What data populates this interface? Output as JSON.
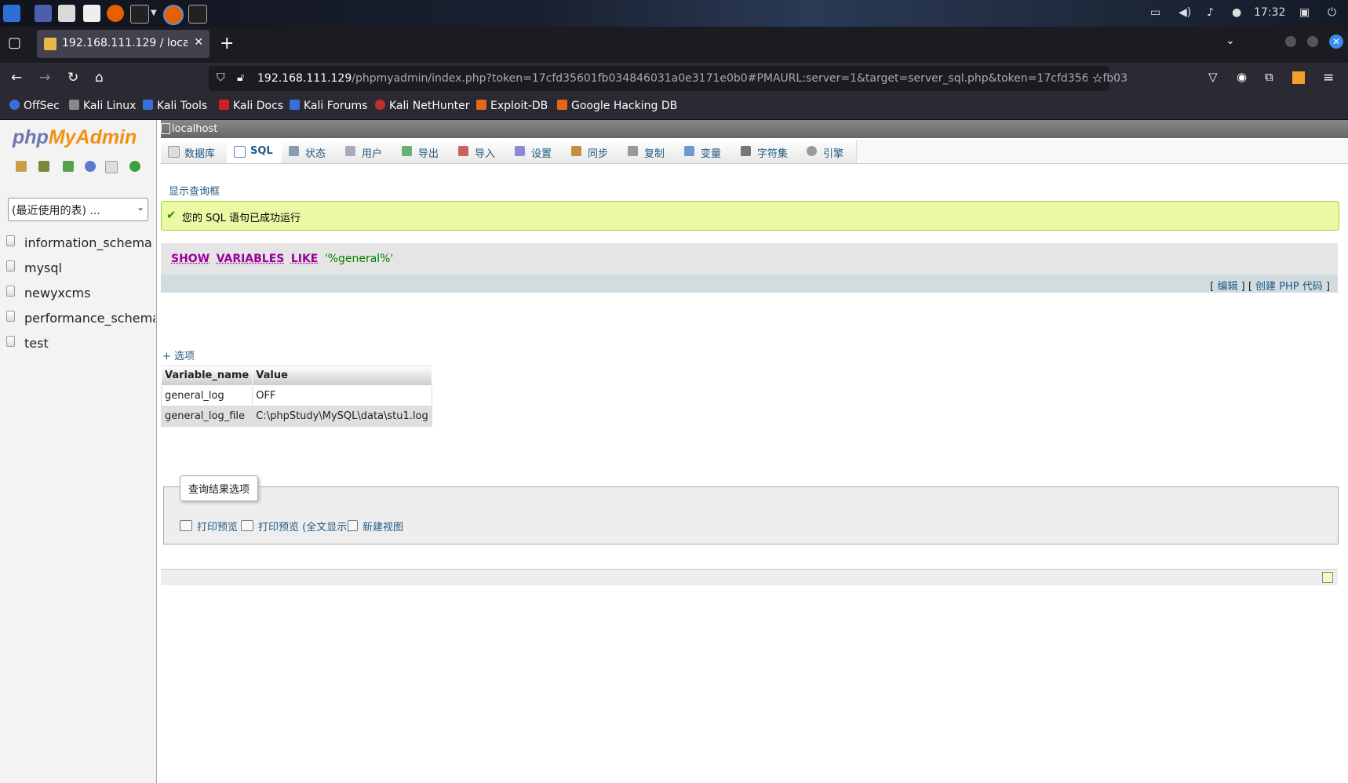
{
  "taskbar": {
    "clock": "17:32"
  },
  "browser": {
    "tab_title": "192.168.111.129 / localhost",
    "url_host": "192.168.111.129",
    "url_rest": "/phpmyadmin/index.php?token=17cfd35601fb034846031a0e3171e0b0#PMAURL:server=1&target=server_sql.php&token=17cfd35601fb03",
    "bookmarks": [
      "OffSec",
      "Kali Linux",
      "Kali Tools",
      "Kali Docs",
      "Kali Forums",
      "Kali NetHunter",
      "Exploit-DB",
      "Google Hacking DB"
    ]
  },
  "sidebar": {
    "logo_php": "php",
    "logo_myadmin": "MyAdmin",
    "recent_tables": "(最近使用的表) ...",
    "databases": [
      "information_schema",
      "mysql",
      "newyxcms",
      "performance_schema",
      "test"
    ]
  },
  "main": {
    "server": "localhost",
    "tabs": [
      "数据库",
      "SQL",
      "状态",
      "用户",
      "导出",
      "导入",
      "设置",
      "同步",
      "复制",
      "变量",
      "字符集",
      "引擎"
    ],
    "active_tab": "SQL",
    "show_query_box": "显示查询框",
    "success_message": "您的 SQL 语句已成功运行",
    "sql": {
      "kw1": "SHOW",
      "kw2": "VARIABLES",
      "kw3": "LIKE",
      "literal": "'%general%'"
    },
    "sql_links": {
      "edit": "编辑",
      "create_php": "创建 PHP 代码"
    },
    "options_link": "+ 选项",
    "table": {
      "headers": [
        "Variable_name",
        "Value"
      ],
      "rows": [
        [
          "general_log",
          "OFF"
        ],
        [
          "general_log_file",
          "C:\\phpStudy\\MySQL\\data\\stu1.log"
        ]
      ]
    },
    "result_options": {
      "legend": "查询结果选项",
      "print_view": "打印预览",
      "print_view_full": "打印预览 (全文显示)",
      "create_view": "新建视图"
    }
  }
}
